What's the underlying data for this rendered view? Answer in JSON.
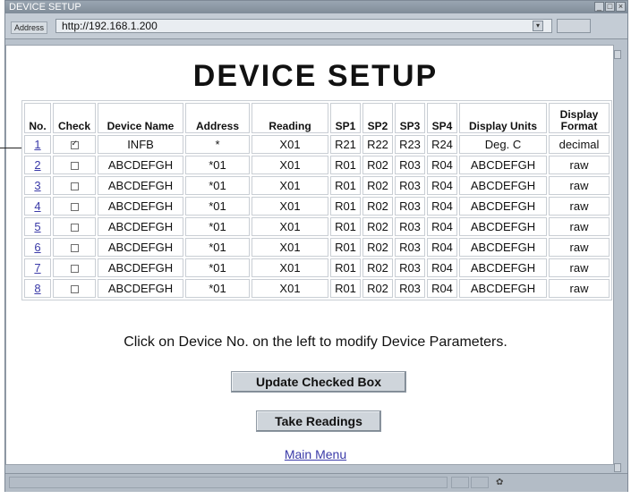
{
  "window": {
    "title": "DEVICE SETUP"
  },
  "address_bar": {
    "label": "Address",
    "url": "http://192.168.1.200"
  },
  "page": {
    "heading": "DEVICE SETUP"
  },
  "table": {
    "headers": [
      "No.",
      "Check",
      "Device Name",
      "Address",
      "Reading",
      "SP1",
      "SP2",
      "SP3",
      "SP4",
      "Display Units",
      "Display\nFormat"
    ],
    "rows": [
      {
        "no": "1",
        "checked": true,
        "name": "INFB",
        "address": "*",
        "reading": "X01",
        "sp1": "R21",
        "sp2": "R22",
        "sp3": "R23",
        "sp4": "R24",
        "units": "Deg. C",
        "format": "decimal"
      },
      {
        "no": "2",
        "checked": false,
        "name": "ABCDEFGH",
        "address": "*01",
        "reading": "X01",
        "sp1": "R01",
        "sp2": "R02",
        "sp3": "R03",
        "sp4": "R04",
        "units": "ABCDEFGH",
        "format": "raw"
      },
      {
        "no": "3",
        "checked": false,
        "name": "ABCDEFGH",
        "address": "*01",
        "reading": "X01",
        "sp1": "R01",
        "sp2": "R02",
        "sp3": "R03",
        "sp4": "R04",
        "units": "ABCDEFGH",
        "format": "raw"
      },
      {
        "no": "4",
        "checked": false,
        "name": "ABCDEFGH",
        "address": "*01",
        "reading": "X01",
        "sp1": "R01",
        "sp2": "R02",
        "sp3": "R03",
        "sp4": "R04",
        "units": "ABCDEFGH",
        "format": "raw"
      },
      {
        "no": "5",
        "checked": false,
        "name": "ABCDEFGH",
        "address": "*01",
        "reading": "X01",
        "sp1": "R01",
        "sp2": "R02",
        "sp3": "R03",
        "sp4": "R04",
        "units": "ABCDEFGH",
        "format": "raw"
      },
      {
        "no": "6",
        "checked": false,
        "name": "ABCDEFGH",
        "address": "*01",
        "reading": "X01",
        "sp1": "R01",
        "sp2": "R02",
        "sp3": "R03",
        "sp4": "R04",
        "units": "ABCDEFGH",
        "format": "raw"
      },
      {
        "no": "7",
        "checked": false,
        "name": "ABCDEFGH",
        "address": "*01",
        "reading": "X01",
        "sp1": "R01",
        "sp2": "R02",
        "sp3": "R03",
        "sp4": "R04",
        "units": "ABCDEFGH",
        "format": "raw"
      },
      {
        "no": "8",
        "checked": false,
        "name": "ABCDEFGH",
        "address": "*01",
        "reading": "X01",
        "sp1": "R01",
        "sp2": "R02",
        "sp3": "R03",
        "sp4": "R04",
        "units": "ABCDEFGH",
        "format": "raw"
      }
    ]
  },
  "instruction": "Click on Device No. on the left to modify Device Parameters.",
  "buttons": {
    "update": "Update Checked Box",
    "take_readings": "Take Readings"
  },
  "links": {
    "main_menu": "Main Menu"
  },
  "icons": {
    "minimize": "minimize-icon",
    "maximize": "maximize-icon",
    "close": "close-icon",
    "dropdown": "dropdown-arrow-icon",
    "status": "network-icon"
  }
}
